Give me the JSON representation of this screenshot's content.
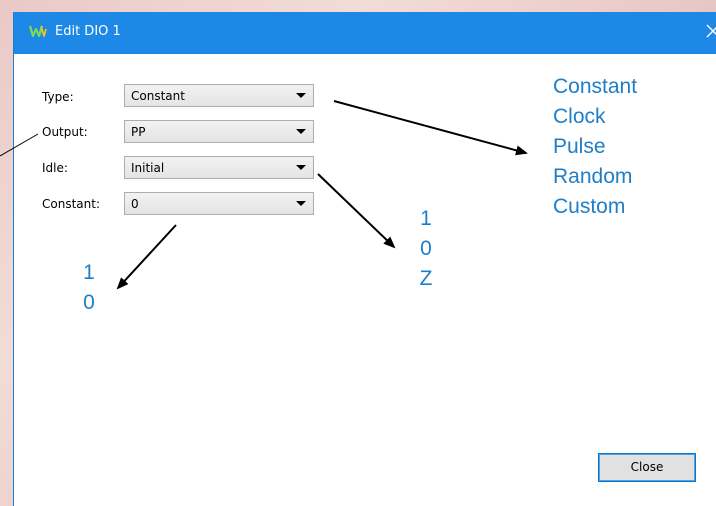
{
  "window": {
    "title": "Edit DIO 1",
    "title_icon": "waveforms-logo-icon",
    "close_icon": "close-icon"
  },
  "form": {
    "type_label": "Type:",
    "type_value": "Constant",
    "output_label": "Output:",
    "output_value": "PP",
    "idle_label": "Idle:",
    "idle_value": "Initial",
    "constant_label": "Constant:",
    "constant_value": "0"
  },
  "annotations": {
    "type_options": [
      "Constant",
      "Clock",
      "Pulse",
      "Random",
      "Custom"
    ],
    "idle_options": [
      "1",
      "0",
      "Z"
    ],
    "constant_options": [
      "1",
      "0"
    ]
  },
  "buttons": {
    "close_label": "Close"
  },
  "colors": {
    "titlebar": "#1d88e5",
    "annotation_text": "#1f7ec8",
    "arrow": "#000000"
  }
}
